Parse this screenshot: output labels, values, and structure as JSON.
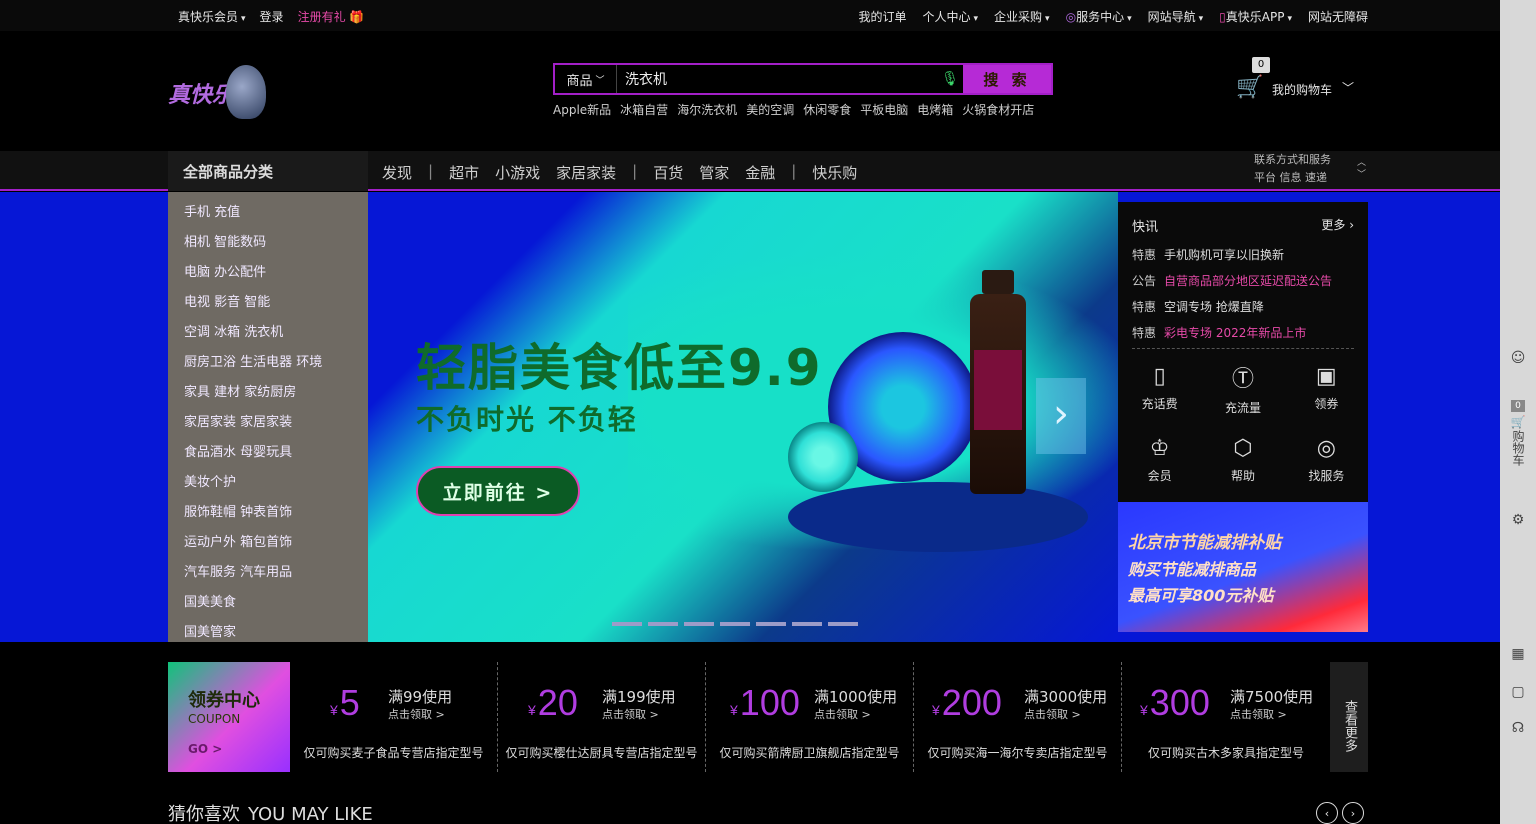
{
  "topbar": {
    "member": "真快乐会员",
    "login": "登录",
    "register": "注册有礼",
    "right": [
      "我的订单",
      "个人中心",
      "企业采购",
      "服务中心",
      "网站导航",
      "真快乐APP",
      "网站无障碍"
    ]
  },
  "logo": {
    "text": "真快乐"
  },
  "search": {
    "category": "商品",
    "value": "洗衣机",
    "button": "搜 索",
    "hotwords": [
      "Apple新品",
      "冰箱自营",
      "海尔洗衣机",
      "美的空调",
      "休闲零食",
      "平板电脑",
      "电烤箱",
      "火锅食材开店"
    ]
  },
  "cart": {
    "count": "0",
    "label": "我的购物车"
  },
  "nav": {
    "all": "全部商品分类",
    "links": [
      "发现",
      "超市",
      "小游戏",
      "家居家装",
      "百货",
      "管家",
      "金融",
      "快乐购"
    ],
    "scroll": [
      "联系方式和服务",
      "平台 信息 速递"
    ]
  },
  "sidecat": [
    "手机 充值",
    "相机 智能数码",
    "电脑 办公配件",
    "电视 影音 智能",
    "空调 冰箱 洗衣机",
    "厨房卫浴 生活电器 环境",
    "家具 建材 家纺厨房",
    "家居家装 家居家装",
    "食品酒水 母婴玩具",
    "美妆个护",
    "服饰鞋帽 钟表首饰",
    "运动户外 箱包首饰",
    "汽车服务 汽车用品",
    "国美美食",
    "国美管家"
  ],
  "hero": {
    "title": "轻脂美食低至9.9",
    "subtitle": "不负时光 不负轻",
    "cta": "立即前往 >"
  },
  "news": {
    "title": "快讯",
    "more": "更多",
    "items": [
      {
        "tag": "特惠",
        "text": "手机购机可享以旧换新",
        "highlight": false
      },
      {
        "tag": "公告",
        "text": "自营商品部分地区延迟配送公告",
        "highlight": true
      },
      {
        "tag": "特惠",
        "text": "空调专场 抢爆直降",
        "highlight": false
      },
      {
        "tag": "特惠",
        "text": "彩电专场 2022年新品上市",
        "highlight": true
      }
    ],
    "services": [
      "充话费",
      "充流量",
      "领券",
      "会员",
      "帮助",
      "找服务"
    ]
  },
  "subsidy": {
    "line1": "北京市节能减排补贴",
    "line2": "购买节能减排商品",
    "line3": "最高可享800元补贴"
  },
  "coupons": {
    "lead": {
      "title": "领券中心",
      "sub": "COUPON",
      "go": "GO >"
    },
    "items": [
      {
        "amount": "5",
        "cond": "满99使用",
        "get": "点击领取 >",
        "desc": "仅可购买麦子食品专营店指定型号"
      },
      {
        "amount": "20",
        "cond": "满199使用",
        "get": "点击领取 >",
        "desc": "仅可购买樱仕达厨具专营店指定型号"
      },
      {
        "amount": "100",
        "cond": "满1000使用",
        "get": "点击领取 >",
        "desc": "仅可购买箭牌厨卫旗舰店指定型号"
      },
      {
        "amount": "200",
        "cond": "满3000使用",
        "get": "点击领取 >",
        "desc": "仅可购买海一海尔专卖店指定型号"
      },
      {
        "amount": "300",
        "cond": "满7500使用",
        "get": "点击领取 >",
        "desc": "仅可购买古木多家具指定型号"
      }
    ],
    "currency": "¥",
    "viewmore": "查看更多"
  },
  "guess": {
    "cn": "猜你喜欢",
    "en": "YOU MAY LIKE"
  },
  "rtool": {
    "cart_count": "0",
    "cart_label": "购物车"
  },
  "colors": {
    "accent": "#b62ad6",
    "banner": "#0617d6",
    "pink": "#e64aa8"
  }
}
